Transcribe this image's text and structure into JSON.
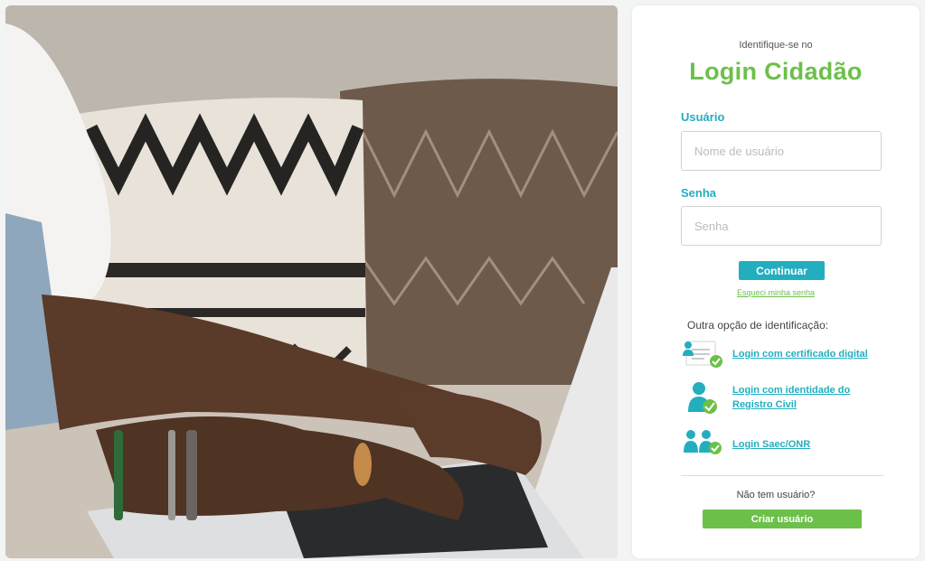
{
  "login": {
    "intro": "Identifique-se no",
    "title": "Login Cidadão",
    "username": {
      "label": "Usuário",
      "placeholder": "Nome de usuário",
      "value": ""
    },
    "password": {
      "label": "Senha",
      "placeholder": "Senha",
      "value": ""
    },
    "continue_label": "Continuar",
    "forgot_label": "Esqueci minha senha",
    "other_options_label": "Outra opção de identificação:",
    "options": [
      {
        "label": "Login com certificado digital",
        "icon": "digital-certificate-icon"
      },
      {
        "label_line1": "Login com identidade do",
        "label_line2": "Registro Civil",
        "icon": "civil-registry-identity-icon"
      },
      {
        "label": "Login Saec/ONR",
        "icon": "saec-onr-users-icon"
      }
    ],
    "no_account_label": "Não tem usuário?",
    "create_label": "Criar usuário"
  },
  "colors": {
    "brand_green": "#6cc04a",
    "accent_teal": "#23aebf",
    "background": "#f3f4f4"
  },
  "photo": {
    "subject": "hands-typing-on-laptop-photo"
  }
}
